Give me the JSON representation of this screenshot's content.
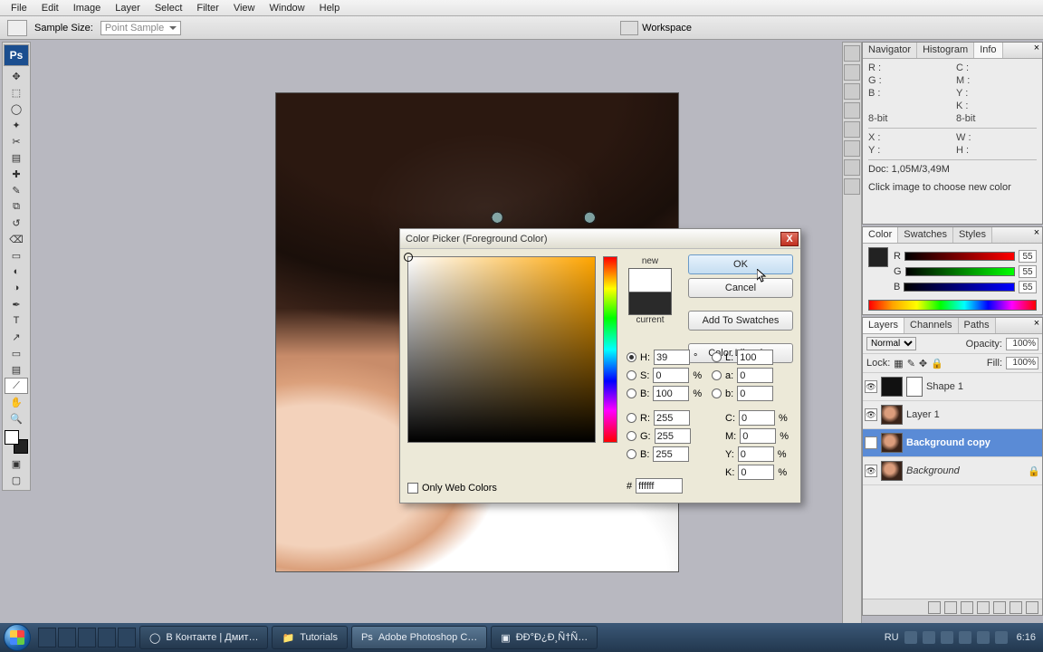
{
  "menubar": [
    "File",
    "Edit",
    "Image",
    "Layer",
    "Select",
    "Filter",
    "View",
    "Window",
    "Help"
  ],
  "optbar": {
    "sample_label": "Sample Size:",
    "sample_value": "Point Sample",
    "workspace": "Workspace"
  },
  "info_panel": {
    "tabs": [
      "Navigator",
      "Histogram",
      "Info"
    ],
    "r": "R :",
    "g": "G :",
    "b": "B :",
    "c": "C :",
    "m": "M :",
    "y": "Y :",
    "k": "K :",
    "x": "X :",
    "yv": "Y :",
    "w": "W :",
    "h": "H :",
    "bit1": "8-bit",
    "bit2": "8-bit",
    "doc": "Doc: 1,05M/3,49M",
    "hint": "Click image to choose new color"
  },
  "color_panel": {
    "tabs": [
      "Color",
      "Swatches",
      "Styles"
    ],
    "r": "R",
    "g": "G",
    "b": "B",
    "val": "55"
  },
  "layers_panel": {
    "tabs": [
      "Layers",
      "Channels",
      "Paths"
    ],
    "mode": "Normal",
    "opacity_lbl": "Opacity:",
    "opacity": "100%",
    "lock_lbl": "Lock:",
    "fill_lbl": "Fill:",
    "fill": "100%",
    "layers": [
      "Shape 1",
      "Layer 1",
      "Background copy",
      "Background"
    ]
  },
  "dialog": {
    "title": "Color Picker (Foreground Color)",
    "new": "new",
    "current": "current",
    "ok": "OK",
    "cancel": "Cancel",
    "add": "Add To Swatches",
    "lib": "Color Libraries",
    "H": "H:",
    "S": "S:",
    "Bv": "B:",
    "L": "L:",
    "a": "a:",
    "b": "b:",
    "R": "R:",
    "G": "G:",
    "Bc": "B:",
    "C": "C:",
    "M": "M:",
    "Y": "Y:",
    "K": "K:",
    "pct": "%",
    "deg": "°",
    "hash": "#",
    "vals": {
      "H": "39",
      "S": "0",
      "Bv": "100",
      "L": "100",
      "a": "0",
      "b": "0",
      "R": "255",
      "G": "255",
      "Bc": "255",
      "C": "0",
      "M": "0",
      "Y": "0",
      "K": "0",
      "hex": "ffffff"
    },
    "web": "Only Web Colors"
  },
  "taskbar": {
    "items": [
      "В Контакте | Дмит…",
      "Tutorials",
      "Adobe Photoshop C…",
      "ĐĐ°Đ¿Đ¸Ñ†Ñ…"
    ],
    "lang": "RU",
    "time": "6:16"
  },
  "toolicons": [
    "↕",
    "⬚",
    "⬚",
    "✂",
    "✎",
    "✐",
    "⟋",
    "⌫",
    "▭",
    "◌",
    "▤",
    "◐",
    "⬒",
    "T",
    "▭",
    "✥",
    "⤢",
    "✋",
    "🔍"
  ]
}
